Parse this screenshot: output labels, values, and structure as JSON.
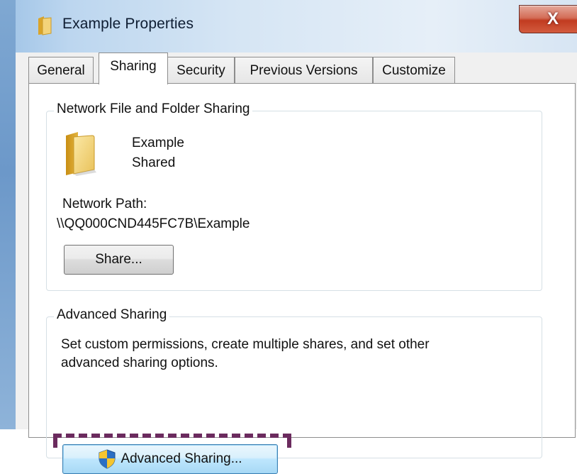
{
  "window": {
    "title": "Example Properties",
    "close_label": "X"
  },
  "tabs": [
    {
      "label": "General",
      "active": false
    },
    {
      "label": "Sharing",
      "active": true
    },
    {
      "label": "Security",
      "active": false
    },
    {
      "label": "Previous Versions",
      "active": false
    },
    {
      "label": "Customize",
      "active": false
    }
  ],
  "network_sharing": {
    "group_title": "Network File and Folder Sharing",
    "folder_name": "Example",
    "share_status": "Shared",
    "path_label": "Network Path:",
    "path_value": "\\\\QQ000CND445FC7B\\Example",
    "share_button": "Share..."
  },
  "advanced_sharing": {
    "group_title": "Advanced Sharing",
    "description_line1": "Set custom permissions, create multiple shares, and set other",
    "description_line2": "advanced sharing options.",
    "button_label": "Advanced Sharing..."
  },
  "colors": {
    "highlight_dash": "#6b2b5e",
    "close_button": "#c13b20",
    "focused_button": "#bee6fd"
  },
  "icons": [
    "folder-icon",
    "close-icon",
    "uac-shield-icon"
  ]
}
